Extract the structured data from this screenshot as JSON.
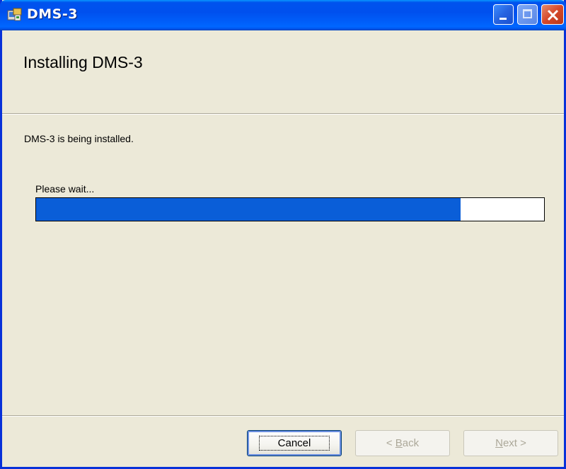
{
  "window": {
    "title": "DMS-3",
    "icon": "installer-icon"
  },
  "caption_buttons": {
    "minimize": "minimize-icon",
    "maximize": "maximize-icon",
    "close": "close-icon"
  },
  "banner": {
    "title": "Installing DMS-3"
  },
  "body": {
    "description": "DMS-3 is being installed.",
    "wait_label": "Please wait..."
  },
  "progress": {
    "value": 0.835,
    "fill_color": "#0a5ed8"
  },
  "buttons": {
    "cancel": "Cancel",
    "back_prefix": "< ",
    "back_accel": "B",
    "back_rest": "ack",
    "next_accel": "N",
    "next_rest": "ext >"
  },
  "colors": {
    "titlebar": "#0053ee",
    "face": "#ece9d8"
  }
}
